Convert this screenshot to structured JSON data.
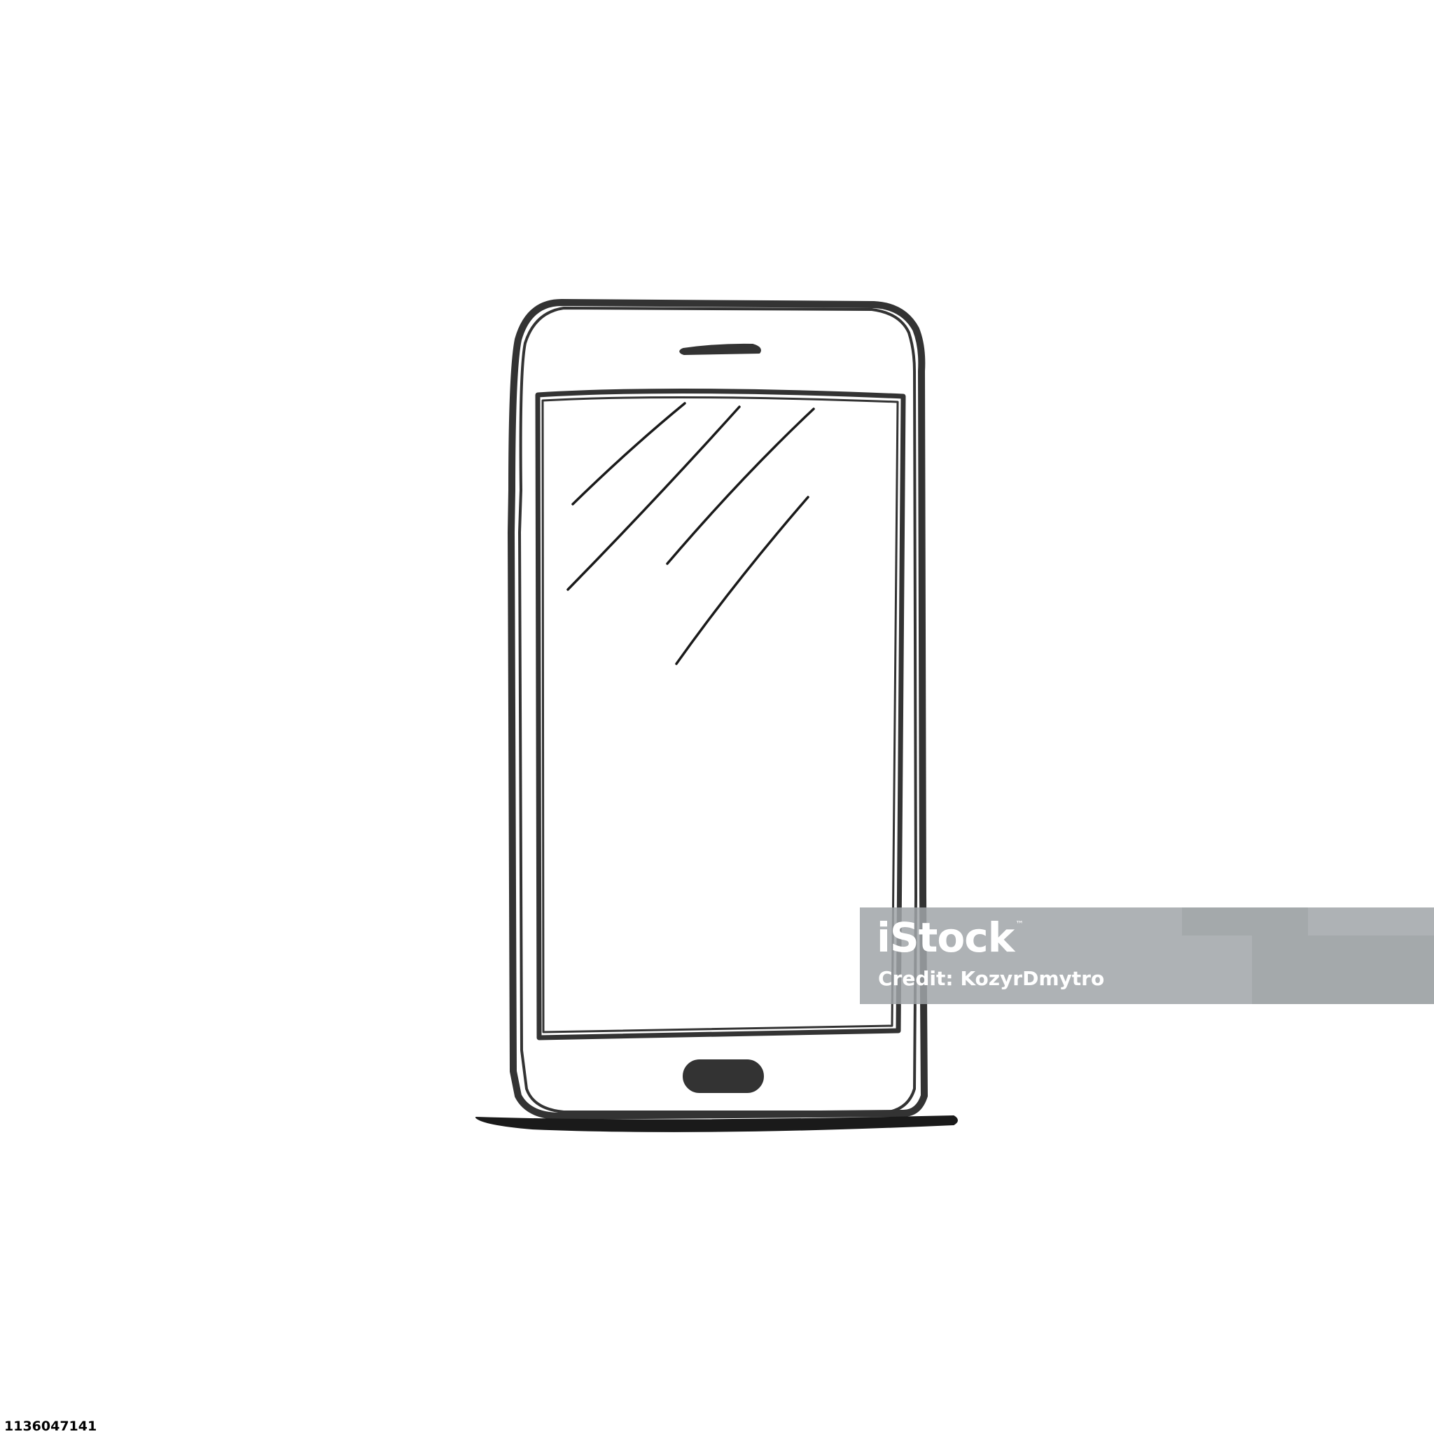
{
  "illustration": {
    "subject": "smartphone",
    "style": "hand-drawn line sketch",
    "stroke_color": "#333333",
    "background_color": "#ffffff"
  },
  "watermark": {
    "brand": "iStock",
    "trademark": "™",
    "credit": "Credit: KozyrDmytro",
    "band_color": "#a0a5a8",
    "text_color": "#ffffff"
  },
  "image_id": "1136047141"
}
